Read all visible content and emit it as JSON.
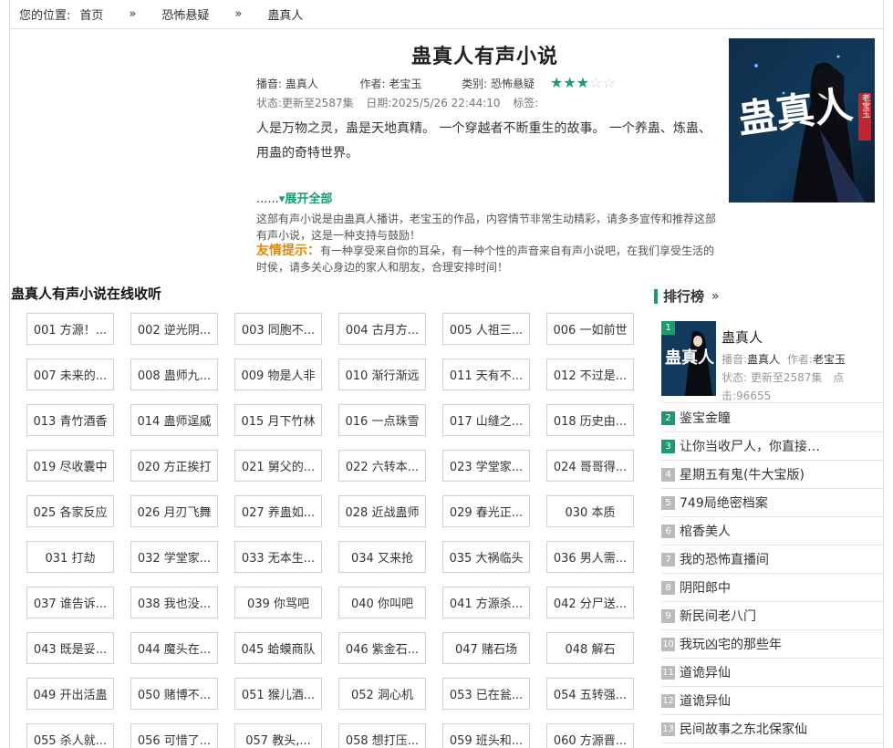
{
  "breadcrumb": {
    "label": "您的位置:",
    "home": "首页",
    "sep": "»",
    "category": "恐怖悬疑",
    "current": "蛊真人"
  },
  "book": {
    "title": "蛊真人有声小说",
    "narrator_label": "播音:",
    "narrator": "蛊真人",
    "author_label": "作者:",
    "author": "老宝玉",
    "category_label": "类别:",
    "category": "恐怖悬疑",
    "rating": 3,
    "rating_max": 5,
    "status": "状态:更新至2587集",
    "date": "日期:2025/5/26 22:44:10",
    "tags_label": "标签:",
    "intro": "人是万物之灵，蛊是天地真精。          一个穿越者不断重生的故事。          一个养蛊、炼蛊、用蛊的奇特世界。",
    "expand_dots": "......",
    "expand_label": "▾展开全部",
    "desc": "这部有声小说是由蛊真人播讲，老宝玉的作品，内容情节非常生动精彩，请多多宣传和推荐这部有声小说，这是一种支持与鼓励！",
    "tip_label": "友情提示：",
    "tip": "有一种享受来自你的耳朵，有一种个性的声音来自有声小说吧，在我们享受生活的时侯，请多关心身边的家人和朋友，合理安排时间！",
    "cover_text": "蛊真人",
    "cover_author": "老宝玉"
  },
  "episodes_title": "蛊真人有声小说在线收听",
  "episodes": [
    "001 方源！...",
    "002 逆光阴...",
    "003 同胞不...",
    "004 古月方...",
    "005 人祖三...",
    "006 一如前世",
    "007 未来的...",
    "008 蛊师九...",
    "009 物是人非",
    "010 渐行渐远",
    "011 天有不...",
    "012 不过是...",
    "013 青竹酒香",
    "014 蛊师逞威",
    "015 月下竹林",
    "016 一点珠雪",
    "017 山缝之...",
    "018 历史由...",
    "019 尽收囊中",
    "020 方正挨打",
    "021 舅父的...",
    "022 六转本...",
    "023 学堂家...",
    "024 哥哥得...",
    "025 各家反应",
    "026 月刃飞舞",
    "027 养蛊如...",
    "028 近战蛊师",
    "029 春光正...",
    "030 本质",
    "031 打劫",
    "032 学堂家...",
    "033 无本生...",
    "034 又来抢",
    "035 大祸临头",
    "036 男人需...",
    "037 谁告诉...",
    "038 我也没...",
    "039 你骂吧",
    "040 你叫吧",
    "041 方源杀...",
    "042 分尸送...",
    "043 既是妥...",
    "044 魔头在...",
    "045 蛤蟆商队",
    "046 紫金石...",
    "047 赌石场",
    "048 解石",
    "049 开出活蛊",
    "050 赌博不...",
    "051 猴儿酒...",
    "052 洞心机",
    "053 已在瓮...",
    "054 五转强...",
    "055 杀人就...",
    "056 可惜了...",
    "057 教头,...",
    "058 想打压...",
    "059 班头和...",
    "060 方源晋..."
  ],
  "ranking": {
    "title": "排行榜",
    "more": "»",
    "top": {
      "num": "1",
      "name": "蛊真人",
      "narrator_label": "播音:",
      "narrator": "蛊真人",
      "author_label": "作者:",
      "author": "老宝玉",
      "status": "状态: 更新至2587集",
      "hits": "点击:96655"
    },
    "items": [
      {
        "num": "2",
        "name": "鉴宝金瞳"
      },
      {
        "num": "3",
        "name": "让你当收尸人，你直接…"
      },
      {
        "num": "4",
        "name": "星期五有鬼(牛大宝版)"
      },
      {
        "num": "5",
        "name": "749局绝密档案"
      },
      {
        "num": "6",
        "name": "棺香美人"
      },
      {
        "num": "7",
        "name": "我的恐怖直播间"
      },
      {
        "num": "8",
        "name": "阴阳郎中"
      },
      {
        "num": "9",
        "name": "新民间老八门"
      },
      {
        "num": "10",
        "name": "我玩凶宅的那些年"
      },
      {
        "num": "11",
        "name": "道诡异仙"
      },
      {
        "num": "12",
        "name": "道诡异仙"
      },
      {
        "num": "13",
        "name": "民间故事之东北保家仙"
      }
    ]
  },
  "colors": {
    "accent": "#1a9c6e",
    "tip": "#e08a00"
  }
}
